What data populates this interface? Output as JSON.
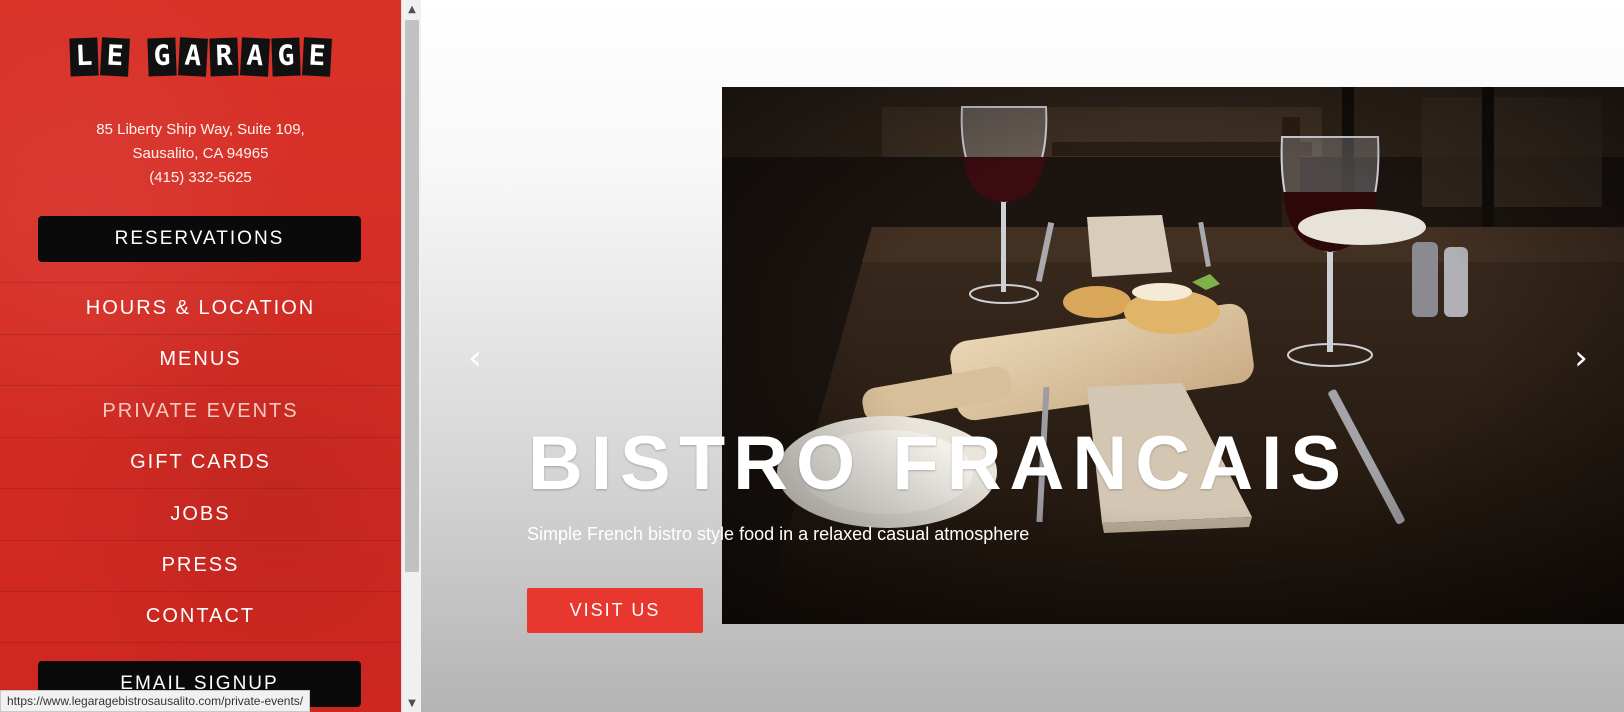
{
  "sidebar": {
    "logo": {
      "words": [
        "LE",
        "GARAGE"
      ]
    },
    "address": {
      "line1": "85 Liberty Ship Way, Suite 109,",
      "line2": "Sausalito, CA 94965",
      "phone": "(415) 332-5625"
    },
    "reservations_label": "RESERVATIONS",
    "nav_items": [
      {
        "label": "HOURS & LOCATION",
        "active": false
      },
      {
        "label": "MENUS",
        "active": false
      },
      {
        "label": "PRIVATE EVENTS",
        "active": true
      },
      {
        "label": "GIFT CARDS",
        "active": false
      },
      {
        "label": "JOBS",
        "active": false
      },
      {
        "label": "PRESS",
        "active": false
      },
      {
        "label": "CONTACT",
        "active": false
      }
    ],
    "email_signup_label": "EMAIL SIGNUP"
  },
  "scrollbar": {
    "up_icon": "chevron-up-icon",
    "down_icon": "chevron-down-icon",
    "up_glyph": "▲",
    "down_glyph": "▼"
  },
  "hero": {
    "title": "BISTRO FRANCAIS",
    "subtitle": "Simple French bistro style food in a relaxed casual atmosphere",
    "cta_label": "VISIT US",
    "prev_icon": "chevron-left-icon",
    "next_icon": "chevron-right-icon",
    "prev_glyph": "‹",
    "next_glyph": "›",
    "image_subject": "bistro-table-photo"
  },
  "status_bar": {
    "url": "https://www.legaragebistrosausalito.com/private-events/"
  },
  "colors": {
    "brand_red": "#d42a24",
    "cta_red": "#e8372f",
    "button_black": "#0a0a0a",
    "text_white": "#ffffff"
  }
}
